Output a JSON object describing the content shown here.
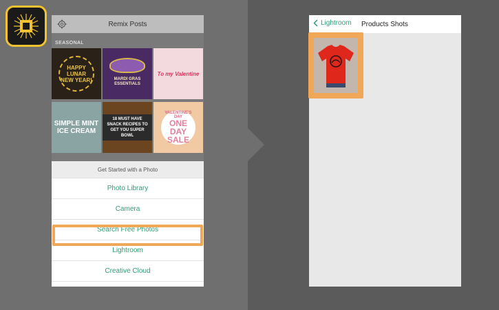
{
  "left_phone": {
    "header_title": "Remix Posts",
    "section_label": "SEASONAL",
    "tiles": [
      {
        "text": "HAPPY LUNAR NEW YEAR!"
      },
      {
        "text": "MARDI GRAS ESSENTIALS"
      },
      {
        "text": "To my Valentine"
      },
      {
        "text": "SIMPLE MINT ICE CREAM"
      },
      {
        "text": "18 MUST HAVE SNACK RECIPES TO GET YOU SUPER BOWL"
      },
      {
        "text_small": "VALENTINE'S DAY",
        "text_large": "ONE DAY SALE"
      }
    ],
    "sheet_title": "Get Started with a Photo",
    "options": [
      "Photo Library",
      "Camera",
      "Search Free Photos",
      "Lightroom",
      "Creative Cloud"
    ]
  },
  "right_phone": {
    "back_label": "Lightroom",
    "title": "Products Shots"
  },
  "colors": {
    "accent_green": "#2f9c73",
    "highlight_orange": "#f0a858",
    "icon_yellow": "#f2c230",
    "tshirt_red": "#e0271b"
  }
}
